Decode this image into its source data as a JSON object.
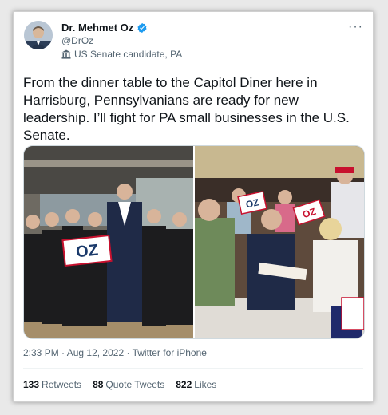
{
  "author": {
    "name": "Dr. Mehmet Oz",
    "handle": "@DrOz",
    "label": "US Senate candidate, PA"
  },
  "icons": {
    "verified": "verified-badge-icon",
    "label": "government-building-icon",
    "more": "more-options-icon"
  },
  "colors": {
    "verified": "#1d9bf0",
    "text": "#0f1419",
    "muted": "#536471"
  },
  "tweet": {
    "text": "From the dinner table to the Capitol Diner here in Harrisburg, Pennsylvanians are ready for new leadership. I’ll fight for PA small businesses in the U.S. Senate."
  },
  "media": {
    "sign_text": "OZ"
  },
  "meta": {
    "time": "2:33 PM",
    "separator": " · ",
    "date": "Aug 12, 2022",
    "source": "Twitter for iPhone"
  },
  "stats": {
    "retweets_count": "133",
    "retweets_label": "Retweets",
    "quotes_count": "88",
    "quotes_label": "Quote Tweets",
    "likes_count": "822",
    "likes_label": "Likes"
  }
}
